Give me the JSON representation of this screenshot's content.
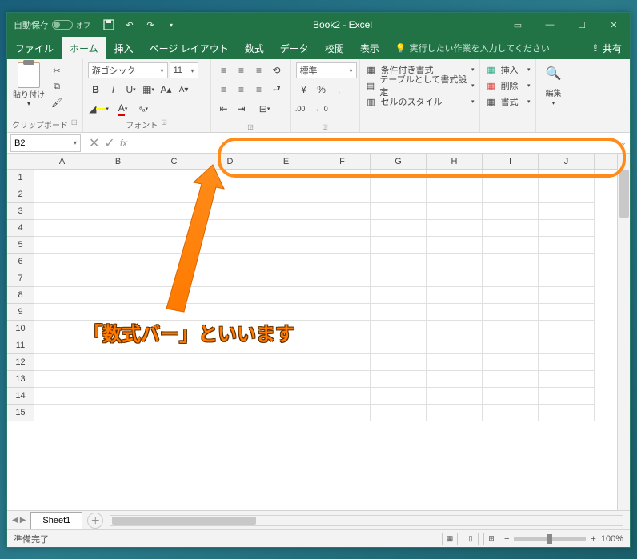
{
  "title": {
    "autosave": "自動保存",
    "autosave_state": "オフ",
    "document": "Book2  -  Excel"
  },
  "menu": {
    "items": [
      "ファイル",
      "ホーム",
      "挿入",
      "ページ レイアウト",
      "数式",
      "データ",
      "校閲",
      "表示"
    ],
    "active_index": 1,
    "tell_me": "実行したい作業を入力してください",
    "share": "共有"
  },
  "ribbon": {
    "clipboard": {
      "paste": "貼り付け",
      "label": "クリップボード"
    },
    "font": {
      "name": "游ゴシック",
      "size": "11",
      "bold": "B",
      "italic": "I",
      "underline": "U",
      "label": "フォント"
    },
    "number": {
      "format": "標準"
    },
    "styles": {
      "conditional": "条件付き書式",
      "table": "テーブルとして書式設定",
      "cell": "セルのスタイル"
    },
    "cells": {
      "insert": "挿入",
      "delete": "削除",
      "format": "書式"
    },
    "editing": {
      "label": "編集"
    }
  },
  "formula_bar": {
    "namebox": "B2",
    "value": ""
  },
  "grid": {
    "cols": [
      "A",
      "B",
      "C",
      "D",
      "E",
      "F",
      "G",
      "H",
      "I",
      "J"
    ],
    "rows": 15
  },
  "tabs": {
    "sheet": "Sheet1"
  },
  "status": {
    "ready": "準備完了",
    "zoom": "100%"
  },
  "annotation": {
    "text": "「数式バー」といいます"
  }
}
